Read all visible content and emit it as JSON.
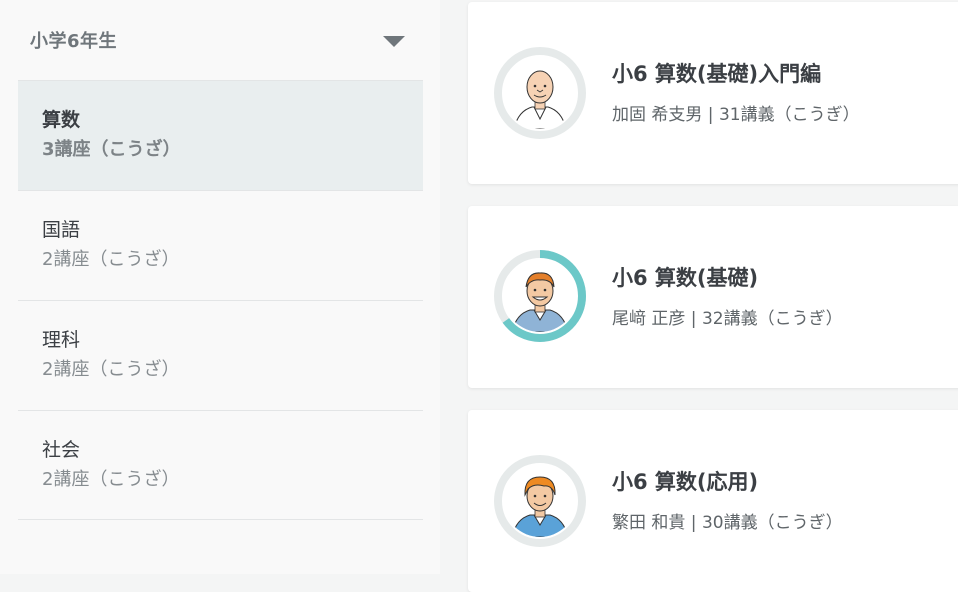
{
  "grade_selector": {
    "label": "小学6年生"
  },
  "subjects": [
    {
      "name": "算数",
      "count": "3講座（こうざ）",
      "active": true
    },
    {
      "name": "国語",
      "count": "2講座（こうざ）",
      "active": false
    },
    {
      "name": "理科",
      "count": "2講座（こうざ）",
      "active": false
    },
    {
      "name": "社会",
      "count": "2講座（こうざ）",
      "active": false
    }
  ],
  "courses": [
    {
      "title": "小6 算数(基礎)入門編",
      "meta": "加固 希支男 | 31講義（こうぎ）",
      "progress": 0
    },
    {
      "title": "小6 算数(基礎)",
      "meta": "尾﨑 正彦 | 32講義（こうぎ）",
      "progress": 0.65
    },
    {
      "title": "小6 算数(応用)",
      "meta": "繁田 和貴 | 30講義（こうぎ）",
      "progress": 0
    }
  ],
  "colors": {
    "progress_ring": "#6cc8c8",
    "ring_track": "#e6eaea",
    "active_bg": "#e9eeef"
  }
}
